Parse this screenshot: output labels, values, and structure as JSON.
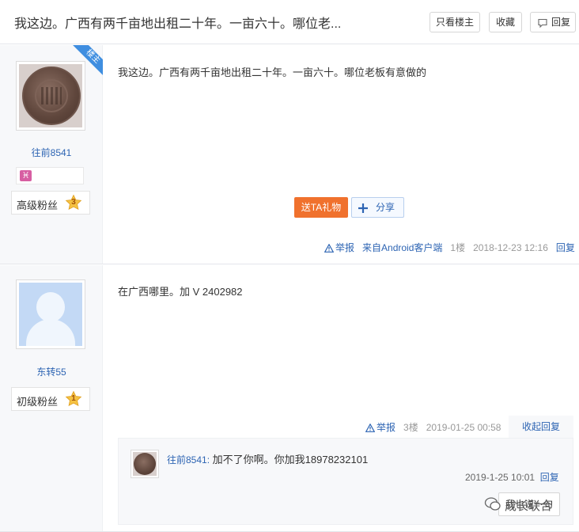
{
  "thread": {
    "title": "我这边。广西有两千亩地出租二十年。一亩六十。哪位老...",
    "only_op_label": "只看楼主",
    "favorite_label": "收藏",
    "reply_label": "回复"
  },
  "posts": [
    {
      "username": "往前8541",
      "op_badge": "楼主",
      "zodiac_glyph": "♓",
      "level_label": "高级粉丝",
      "level_number": "3",
      "content": "我这边。广西有两千亩地出租二十年。一亩六十。哪位老板有意做的",
      "gift_label": "送TA礼物",
      "share_label": "分享",
      "report_label": "举报",
      "source": "来自Android客户端",
      "floor": "1楼",
      "time": "2018-12-23 12:16",
      "reply_label": "回复"
    },
    {
      "username": "东转55",
      "level_label": "初级粉丝",
      "level_number": "1",
      "content": "在广西哪里。加 V 2402982",
      "report_label": "举报",
      "floor": "3楼",
      "time": "2019-01-25 00:58",
      "collapse_label": "收起回复",
      "sub_reply": {
        "username": "往前8541:",
        "text": "加不了你啊。你加我18978232101",
        "time": "2019-1-25 10:01",
        "reply_label": "回复",
        "input_label": "我也说一句"
      }
    }
  ],
  "watermark": {
    "text": "成长联合"
  },
  "colors": {
    "link_blue": "#2d64b3",
    "gift_orange": "#f0712d",
    "op_badge_blue": "#3f8ee0",
    "sidebar_bg": "#f7f8fa",
    "star_gold": "#f5c242"
  }
}
